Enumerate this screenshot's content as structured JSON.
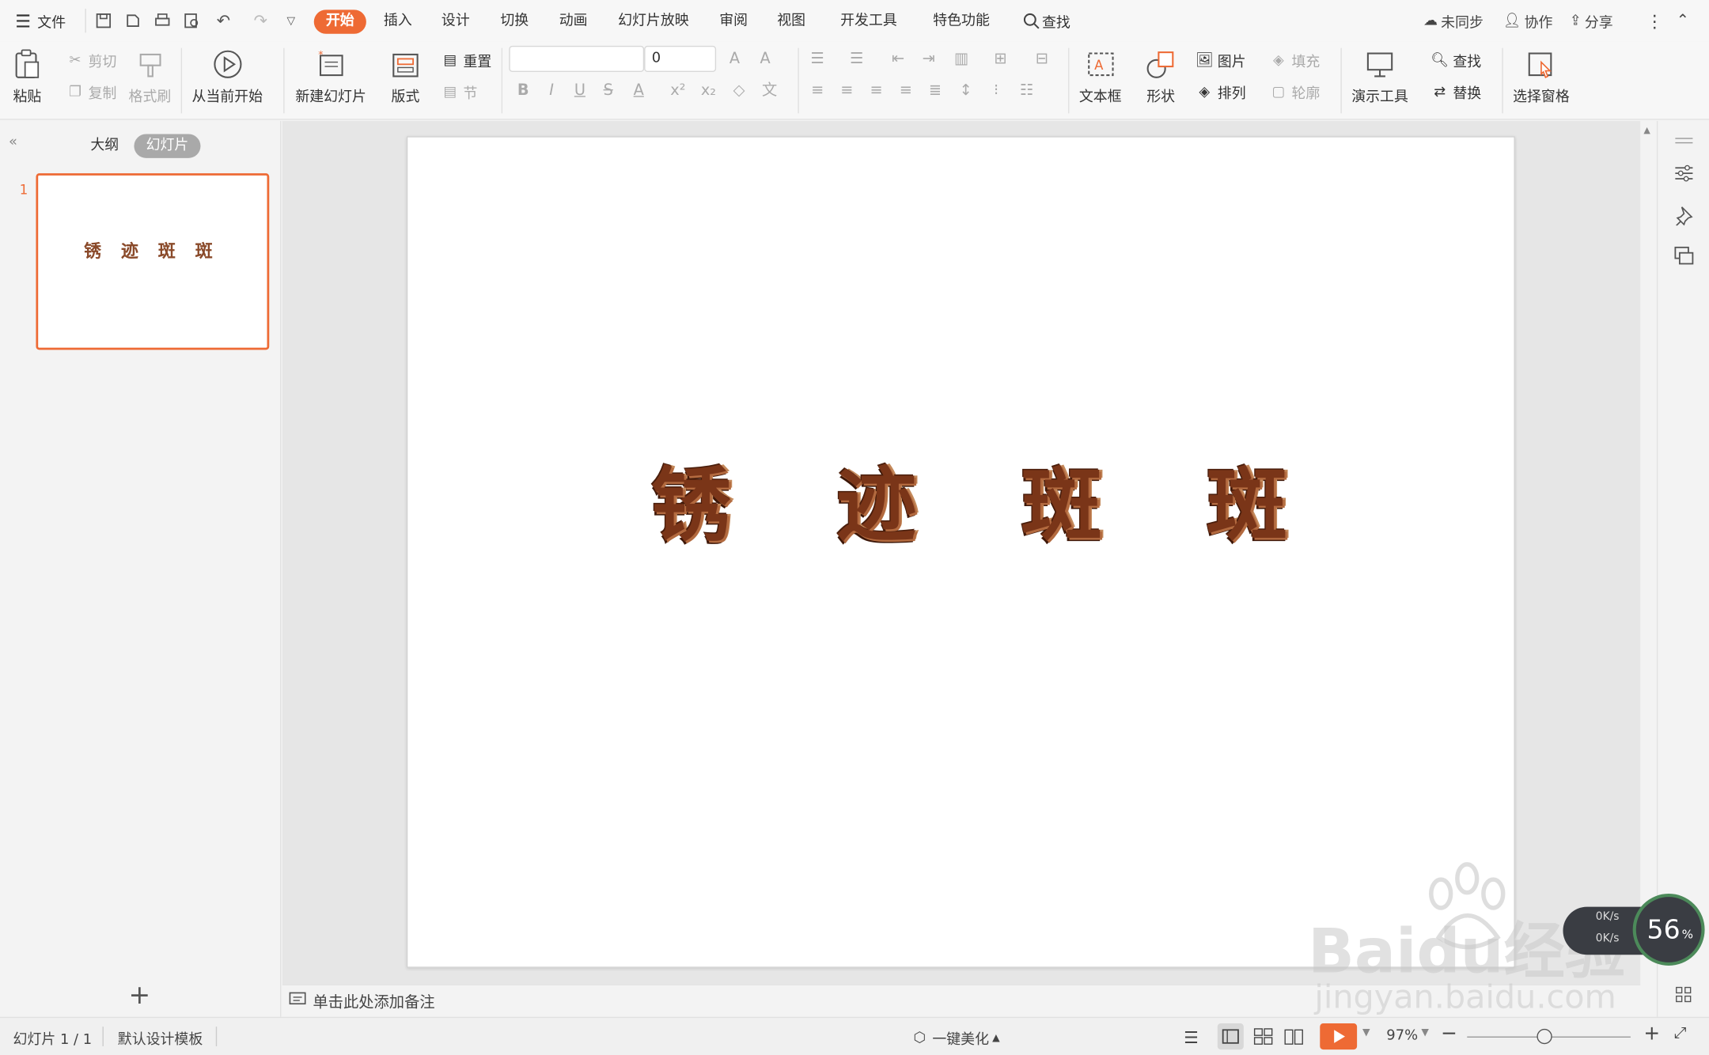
{
  "menubar": {
    "file_label": "文件",
    "tabs": [
      "开始",
      "插入",
      "设计",
      "切换",
      "动画",
      "幻灯片放映",
      "审阅",
      "视图",
      "开发工具",
      "特色功能"
    ],
    "search_label": "查找",
    "sync_label": "未同步",
    "collab_label": "协作",
    "share_label": "分享"
  },
  "ribbon": {
    "paste": "粘贴",
    "cut": "剪切",
    "copy": "复制",
    "format_painter": "格式刷",
    "from_current": "从当前开始",
    "new_slide": "新建幻灯片",
    "layout": "版式",
    "reset": "重置",
    "section": "节",
    "font_size": "0",
    "textbox": "文本框",
    "shape": "形状",
    "picture": "图片",
    "fill": "填充",
    "arrange": "排列",
    "outline": "轮廓",
    "presentation_tools": "演示工具",
    "find": "查找",
    "replace": "替换",
    "selection_pane": "选择窗格"
  },
  "leftpanel": {
    "outline_tab": "大纲",
    "slides_tab": "幻灯片",
    "slide_number": "1"
  },
  "slide": {
    "chars": [
      "锈",
      "迹",
      "斑",
      "斑"
    ]
  },
  "notes": {
    "placeholder": "单击此处添加备注"
  },
  "statusbar": {
    "slide_count": "幻灯片 1 / 1",
    "template": "默认设计模板",
    "beautify": "一键美化",
    "zoom": "97%"
  },
  "overlay": {
    "speed_percent": "56",
    "speed_unit": "%",
    "up_rate": "0K/s",
    "down_rate": "0K/s",
    "watermark_main": "Baidu经验",
    "watermark_url": "jingyan.baidu.com"
  },
  "colors": {
    "accent": "#ee6a34",
    "rust": "#7a3518"
  }
}
